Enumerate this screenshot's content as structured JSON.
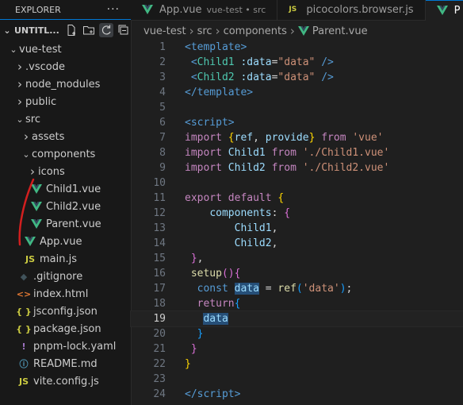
{
  "explorer": {
    "title": "EXPLORER",
    "more": "···",
    "workspace": "UNTITL...",
    "tree": [
      {
        "label": "vue-test",
        "depth": 0,
        "kind": "folder-open"
      },
      {
        "label": ".vscode",
        "depth": 1,
        "kind": "folder"
      },
      {
        "label": "node_modules",
        "depth": 1,
        "kind": "folder"
      },
      {
        "label": "public",
        "depth": 1,
        "kind": "folder"
      },
      {
        "label": "src",
        "depth": 1,
        "kind": "folder-open"
      },
      {
        "label": "assets",
        "depth": 2,
        "kind": "folder"
      },
      {
        "label": "components",
        "depth": 2,
        "kind": "folder-open"
      },
      {
        "label": "icons",
        "depth": 3,
        "kind": "folder"
      },
      {
        "label": "Child1.vue",
        "depth": 3,
        "kind": "vue"
      },
      {
        "label": "Child2.vue",
        "depth": 3,
        "kind": "vue"
      },
      {
        "label": "Parent.vue",
        "depth": 3,
        "kind": "vue"
      },
      {
        "label": "App.vue",
        "depth": 2,
        "kind": "vue"
      },
      {
        "label": "main.js",
        "depth": 2,
        "kind": "js"
      },
      {
        "label": ".gitignore",
        "depth": 1,
        "kind": "git"
      },
      {
        "label": "index.html",
        "depth": 1,
        "kind": "html"
      },
      {
        "label": "jsconfig.json",
        "depth": 1,
        "kind": "json"
      },
      {
        "label": "package.json",
        "depth": 1,
        "kind": "json"
      },
      {
        "label": "pnpm-lock.yaml",
        "depth": 1,
        "kind": "yaml"
      },
      {
        "label": "README.md",
        "depth": 1,
        "kind": "info"
      },
      {
        "label": "vite.config.js",
        "depth": 1,
        "kind": "js"
      }
    ]
  },
  "tabs": [
    {
      "label": "App.vue",
      "desc": "vue-test • src",
      "kind": "vue",
      "active": false
    },
    {
      "label": "picocolors.browser.js",
      "desc": "",
      "kind": "js",
      "active": false
    },
    {
      "label": "P",
      "desc": "",
      "kind": "vue",
      "active": true
    }
  ],
  "breadcrumb": [
    "vue-test",
    "src",
    "components",
    "Parent.vue"
  ],
  "icon_labels": {
    "js": "JS",
    "json": "{ }",
    "yaml": "!",
    "git": "◆",
    "html": "<>",
    "info": "ⓘ"
  },
  "code": {
    "current_line": 19,
    "lines": [
      [
        [
          "t-tag",
          "<"
        ],
        [
          "t-tag",
          "template"
        ],
        [
          "t-tag",
          ">"
        ]
      ],
      [
        [
          "t-punc",
          " "
        ],
        [
          "t-tag",
          "<"
        ],
        [
          "t-tagname",
          "Child1"
        ],
        [
          "t-punc",
          " "
        ],
        [
          "t-attr",
          ":data"
        ],
        [
          "t-punc",
          "="
        ],
        [
          "t-str",
          "\"data\""
        ],
        [
          "t-punc",
          " "
        ],
        [
          "t-tag",
          "/>"
        ]
      ],
      [
        [
          "t-punc",
          " "
        ],
        [
          "t-tag",
          "<"
        ],
        [
          "t-tagname",
          "Child2"
        ],
        [
          "t-punc",
          " "
        ],
        [
          "t-attr",
          ":data"
        ],
        [
          "t-punc",
          "="
        ],
        [
          "t-str",
          "\"data\""
        ],
        [
          "t-punc",
          " "
        ],
        [
          "t-tag",
          "/>"
        ]
      ],
      [
        [
          "t-tag",
          "</"
        ],
        [
          "t-tag",
          "template"
        ],
        [
          "t-tag",
          ">"
        ]
      ],
      [],
      [
        [
          "t-tag",
          "<"
        ],
        [
          "t-tag",
          "script"
        ],
        [
          "t-tag",
          ">"
        ]
      ],
      [
        [
          "t-kw",
          "import"
        ],
        [
          "t-punc",
          " "
        ],
        [
          "t-br",
          "{"
        ],
        [
          "t-var",
          "ref"
        ],
        [
          "t-punc",
          ", "
        ],
        [
          "t-var",
          "provide"
        ],
        [
          "t-br",
          "}"
        ],
        [
          "t-punc",
          " "
        ],
        [
          "t-kw",
          "from"
        ],
        [
          "t-punc",
          " "
        ],
        [
          "t-str",
          "'vue'"
        ]
      ],
      [
        [
          "t-kw",
          "import"
        ],
        [
          "t-punc",
          " "
        ],
        [
          "t-var",
          "Child1"
        ],
        [
          "t-punc",
          " "
        ],
        [
          "t-kw",
          "from"
        ],
        [
          "t-punc",
          " "
        ],
        [
          "t-str",
          "'./Child1.vue'"
        ]
      ],
      [
        [
          "t-kw",
          "import"
        ],
        [
          "t-punc",
          " "
        ],
        [
          "t-var",
          "Child2"
        ],
        [
          "t-punc",
          " "
        ],
        [
          "t-kw",
          "from"
        ],
        [
          "t-punc",
          " "
        ],
        [
          "t-str",
          "'./Child2.vue'"
        ]
      ],
      [],
      [
        [
          "t-kw",
          "export"
        ],
        [
          "t-punc",
          " "
        ],
        [
          "t-kw",
          "default"
        ],
        [
          "t-punc",
          " "
        ],
        [
          "t-br",
          "{"
        ]
      ],
      [
        [
          "t-punc",
          "    "
        ],
        [
          "t-var",
          "components"
        ],
        [
          "t-punc",
          ": "
        ],
        [
          "t-br2",
          "{"
        ]
      ],
      [
        [
          "t-punc",
          "        "
        ],
        [
          "t-var",
          "Child1"
        ],
        [
          "t-punc",
          ","
        ]
      ],
      [
        [
          "t-punc",
          "        "
        ],
        [
          "t-var",
          "Child2"
        ],
        [
          "t-punc",
          ","
        ]
      ],
      [
        [
          "t-punc",
          " "
        ],
        [
          "t-br2",
          "}"
        ],
        [
          "t-punc",
          ","
        ]
      ],
      [
        [
          "t-punc",
          " "
        ],
        [
          "t-fn",
          "setup"
        ],
        [
          "t-br2",
          "()"
        ],
        [
          "t-br2",
          "{"
        ]
      ],
      [
        [
          "t-punc",
          "  "
        ],
        [
          "t-tag",
          "const"
        ],
        [
          "t-punc",
          " "
        ],
        [
          "hl t-var",
          "data"
        ],
        [
          "t-punc",
          " = "
        ],
        [
          "t-fn",
          "ref"
        ],
        [
          "t-br3",
          "("
        ],
        [
          "t-str",
          "'data'"
        ],
        [
          "t-br3",
          ")"
        ],
        [
          "t-punc",
          ";"
        ]
      ],
      [
        [
          "t-punc",
          "  "
        ],
        [
          "t-kw",
          "return"
        ],
        [
          "t-br3",
          "{"
        ]
      ],
      [
        [
          "t-punc",
          "   "
        ],
        [
          "hl t-var",
          "data"
        ]
      ],
      [
        [
          "t-punc",
          "  "
        ],
        [
          "t-br3",
          "}"
        ]
      ],
      [
        [
          "t-punc",
          " "
        ],
        [
          "t-br2",
          "}"
        ]
      ],
      [
        [
          "t-br",
          "}"
        ]
      ],
      [],
      [
        [
          "t-tag",
          "</"
        ],
        [
          "t-tag",
          "script"
        ],
        [
          "t-tag",
          ">"
        ]
      ]
    ]
  }
}
